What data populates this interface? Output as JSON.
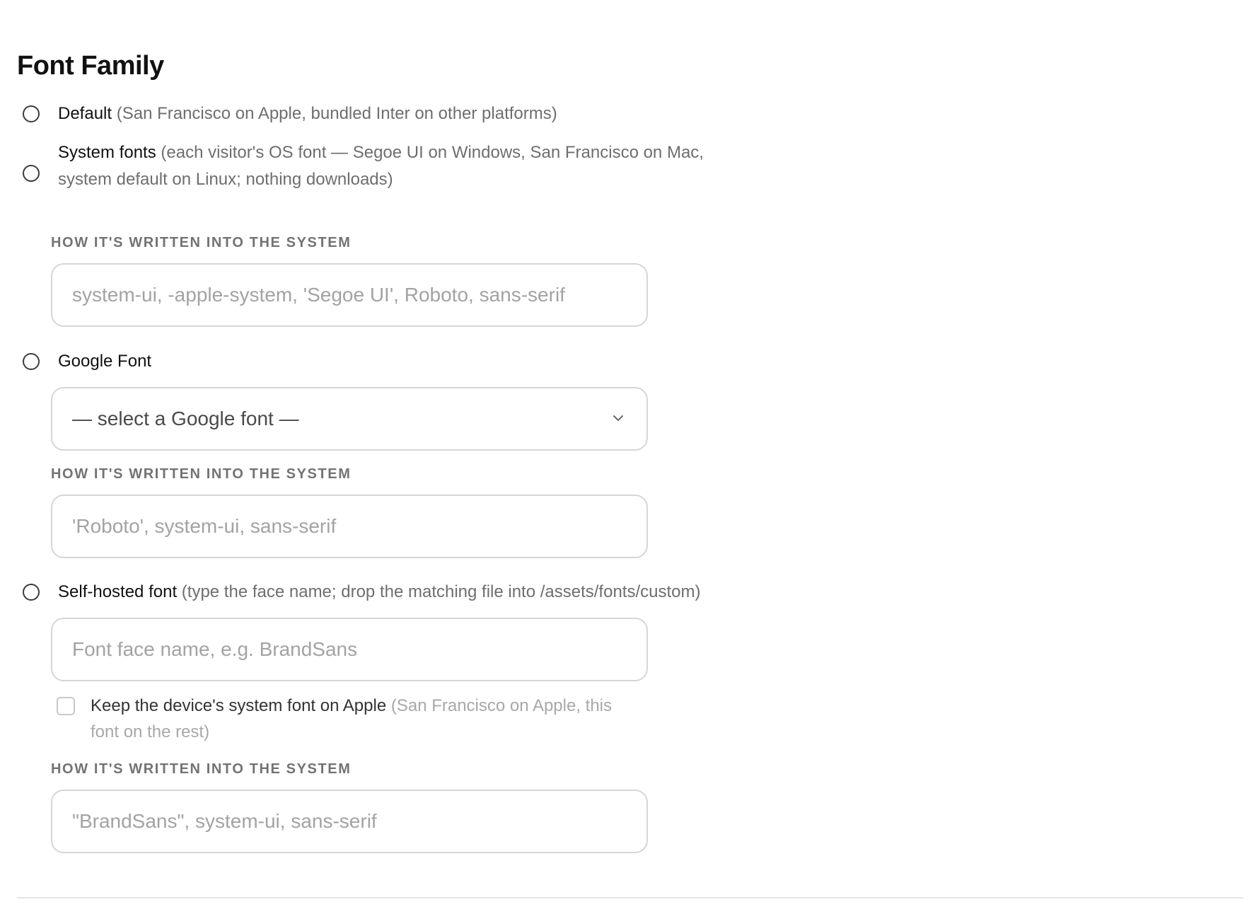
{
  "section": {
    "title": "Font Family"
  },
  "options": {
    "default": {
      "label": "Default",
      "description": "(San Francisco on Apple, bundled Inter on other platforms)"
    },
    "system": {
      "label": "System fonts",
      "description": "(each visitor's OS font — Segoe UI on Windows, San Francisco on Mac, system default on Linux; nothing downloads)",
      "written_label": "HOW IT'S WRITTEN INTO THE SYSTEM",
      "written_value": "system-ui, -apple-system, 'Segoe UI', Roboto, sans-serif"
    },
    "google": {
      "label": "Google Font",
      "select_value": "— select a Google font —",
      "written_label": "HOW IT'S WRITTEN INTO THE SYSTEM",
      "written_value": "'Roboto', system-ui, sans-serif"
    },
    "self_hosted": {
      "label": "Self-hosted font",
      "description": "(type the face name; drop the matching file into /assets/fonts/custom)",
      "name_placeholder": "Font face name, e.g. BrandSans",
      "keep_system_label": "Keep the device's system font on Apple",
      "keep_system_description": "(San Francisco on Apple, this font on the rest)",
      "written_label": "HOW IT'S WRITTEN INTO THE SYSTEM",
      "written_value": "\"BrandSans\", system-ui, sans-serif"
    }
  },
  "icons": {
    "select_chevron": "chevron-down-icon"
  },
  "colors": {
    "text": "#111111",
    "muted": "#6e6e6e",
    "border": "#d6d6d6",
    "caption": "#737373"
  }
}
